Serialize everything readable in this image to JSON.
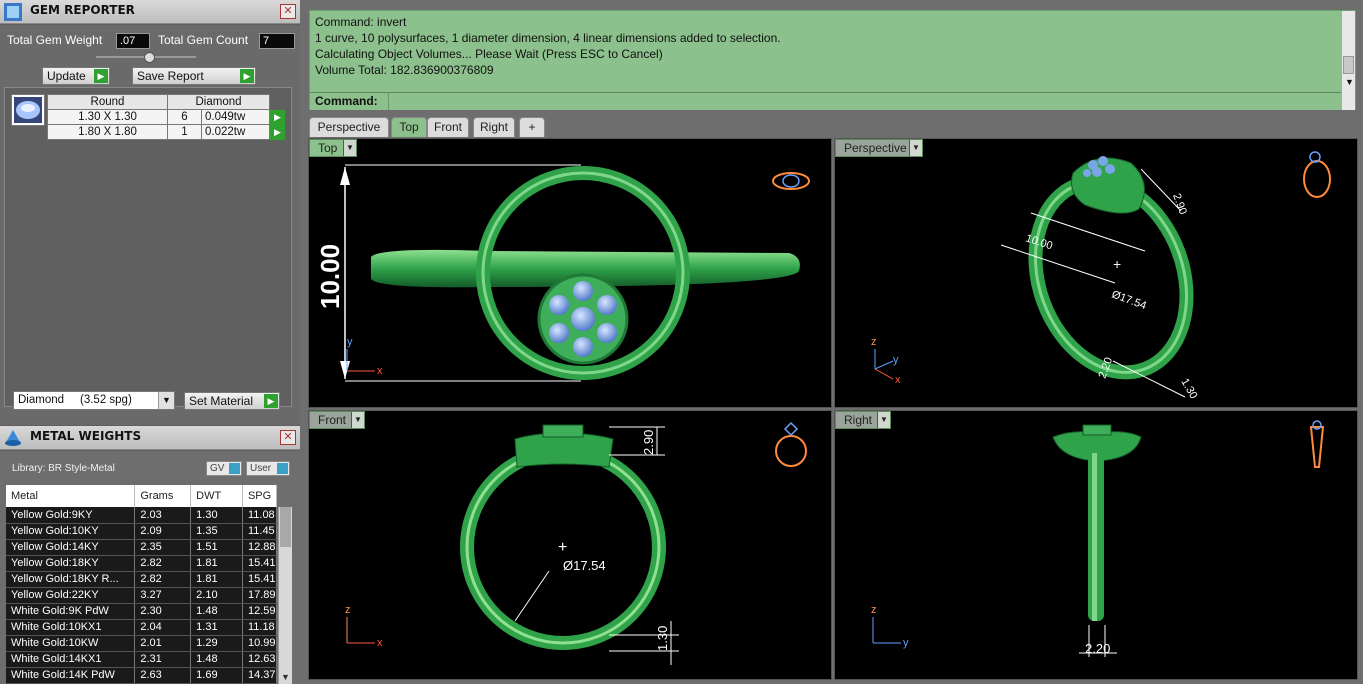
{
  "gem_reporter": {
    "title": "GEM REPORTER",
    "total_weight_label": "Total Gem Weight",
    "total_weight_value": ".07",
    "total_count_label": "Total Gem Count",
    "total_count_value": "7",
    "update_label": "Update",
    "save_report_label": "Save Report",
    "table_headers": [
      "Round",
      "Diamond"
    ],
    "rows": [
      {
        "size": "1.30 X 1.30",
        "count": "6",
        "weight": "0.049tw"
      },
      {
        "size": "1.80 X 1.80",
        "count": "1",
        "weight": "0.022tw"
      }
    ],
    "material_select": "Diamond     (3.52 spg)",
    "set_material_label": "Set Material"
  },
  "metal_weights": {
    "title": "METAL WEIGHTS",
    "library": "Library: BR Style-Metal",
    "gv_label": "GV",
    "user_label": "User",
    "headers": [
      "Metal",
      "Grams",
      "DWT",
      "SPG"
    ],
    "rows": [
      [
        "Yellow Gold:9KY",
        "2.03",
        "1.30",
        "11.08"
      ],
      [
        "Yellow Gold:10KY",
        "2.09",
        "1.35",
        "11.45"
      ],
      [
        "Yellow Gold:14KY",
        "2.35",
        "1.51",
        "12.88"
      ],
      [
        "Yellow Gold:18KY",
        "2.82",
        "1.81",
        "15.41"
      ],
      [
        "Yellow Gold:18KY R...",
        "2.82",
        "1.81",
        "15.41"
      ],
      [
        "Yellow Gold:22KY",
        "3.27",
        "2.10",
        "17.89"
      ],
      [
        "White Gold:9K PdW",
        "2.30",
        "1.48",
        "12.59"
      ],
      [
        "White Gold:10KX1",
        "2.04",
        "1.31",
        "11.18"
      ],
      [
        "White Gold:10KW",
        "2.01",
        "1.29",
        "10.99"
      ],
      [
        "White Gold:14KX1",
        "2.31",
        "1.48",
        "12.63"
      ],
      [
        "White Gold:14K PdW",
        "2.63",
        "1.69",
        "14.37"
      ]
    ]
  },
  "command": {
    "lines": [
      "Command: invert",
      "1 curve, 10 polysurfaces, 1 diameter dimension, 4 linear dimensions added to selection.",
      "Calculating Object Volumes... Please Wait (Press ESC to Cancel)",
      "Volume Total: 182.836900376809"
    ],
    "prompt": "Command:"
  },
  "tabs": [
    "Perspective",
    "Top",
    "Front",
    "Right",
    "+"
  ],
  "viewports": {
    "top": {
      "label": "Top",
      "dim": "10.00",
      "axis_x": "x",
      "axis_y": "y"
    },
    "perspective": {
      "label": "Perspective",
      "dia": "Ø17.54",
      "d1": "2.90",
      "d2": "1.30",
      "d3": "2.20",
      "d4": "10.00",
      "axis_x": "x",
      "axis_y": "y",
      "axis_z": "z"
    },
    "front": {
      "label": "Front",
      "dia": "Ø17.54",
      "d1": "2.90",
      "d2": "1.30",
      "axis_x": "x",
      "axis_z": "z"
    },
    "right": {
      "label": "Right",
      "d1": "2.20",
      "axis_y": "y",
      "axis_z": "z"
    }
  },
  "colors": {
    "ring_green": "#2fa24a",
    "gem_blue": "#7aa6e8",
    "panel_green": "#8cc08c"
  }
}
